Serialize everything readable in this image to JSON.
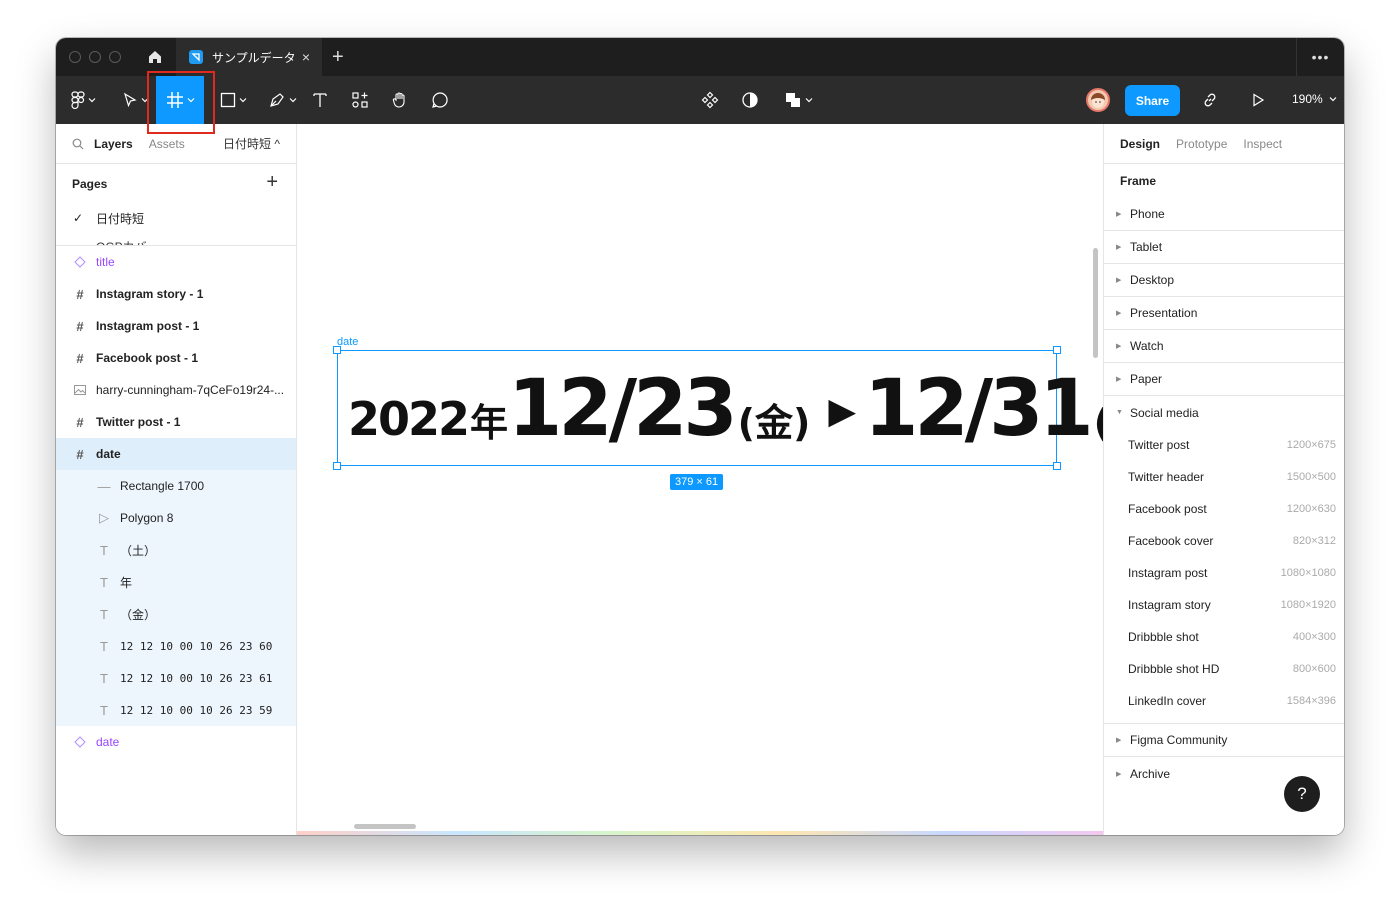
{
  "tabs": {
    "file_name": "サンプルデータ",
    "close": "×",
    "new": "+"
  },
  "toolbar": {
    "share_label": "Share",
    "zoom": "190%",
    "more": "•••"
  },
  "left_panel": {
    "tab_layers": "Layers",
    "tab_assets": "Assets",
    "current_page": "日付時短 ^",
    "pages_heading": "Pages",
    "add_page": "+",
    "pages": [
      {
        "label": "日付時短",
        "selected": true
      },
      {
        "label": "OGPカバ"
      }
    ],
    "layers": [
      {
        "label": "title",
        "icon": "component-icon"
      },
      {
        "label": "Instagram story - 1",
        "icon": "frame-icon"
      },
      {
        "label": "Instagram post - 1",
        "icon": "frame-icon"
      },
      {
        "label": "Facebook post - 1",
        "icon": "frame-icon"
      },
      {
        "label": "harry-cunningham-7qCeFo19r24-...",
        "icon": "image-icon"
      },
      {
        "label": "Twitter post - 1",
        "icon": "frame-icon"
      },
      {
        "label": "date",
        "icon": "frame-icon"
      },
      {
        "label": "Rectangle 1700",
        "icon": "line-icon"
      },
      {
        "label": "Polygon 8",
        "icon": "polygon-icon"
      },
      {
        "label": "（土）",
        "icon": "text-icon"
      },
      {
        "label": "年",
        "icon": "text-icon"
      },
      {
        "label": "（金）",
        "icon": "text-icon"
      },
      {
        "label": "12 12 10 00 10 26 23 60",
        "icon": "text-icon"
      },
      {
        "label": "12 12 10 00 10 26 23 61",
        "icon": "text-icon"
      },
      {
        "label": "12 12 10 00 10 26 23 59",
        "icon": "text-icon"
      },
      {
        "label": "date",
        "icon": "component-icon"
      }
    ]
  },
  "canvas": {
    "frame_label": "date",
    "year": "2022",
    "year_kanji": "年",
    "start_date": "12/23",
    "start_day": "(金)",
    "arrow": "▶",
    "end_date": "12/31",
    "end_day": "(土)",
    "size_badge": "379 × 61"
  },
  "right_panel": {
    "tabs": [
      "Design",
      "Prototype",
      "Inspect"
    ],
    "section_title": "Frame",
    "categories_before": [
      "Phone",
      "Tablet",
      "Desktop",
      "Presentation",
      "Watch",
      "Paper"
    ],
    "open_category": "Social media",
    "presets": [
      {
        "name": "Twitter post",
        "size": "1200×675"
      },
      {
        "name": "Twitter header",
        "size": "1500×500"
      },
      {
        "name": "Facebook post",
        "size": "1200×630"
      },
      {
        "name": "Facebook cover",
        "size": "820×312"
      },
      {
        "name": "Instagram post",
        "size": "1080×1080"
      },
      {
        "name": "Instagram story",
        "size": "1080×1920"
      },
      {
        "name": "Dribbble shot",
        "size": "400×300"
      },
      {
        "name": "Dribbble shot HD",
        "size": "800×600"
      },
      {
        "name": "LinkedIn cover",
        "size": "1584×396"
      }
    ],
    "categories_after": [
      "Figma Community",
      "Archive"
    ],
    "help": "?"
  },
  "colors": {
    "accent": "#0d99ff",
    "highlight": "#e02a20",
    "component": "#9747ff",
    "chrome": "#2c2c2c"
  }
}
